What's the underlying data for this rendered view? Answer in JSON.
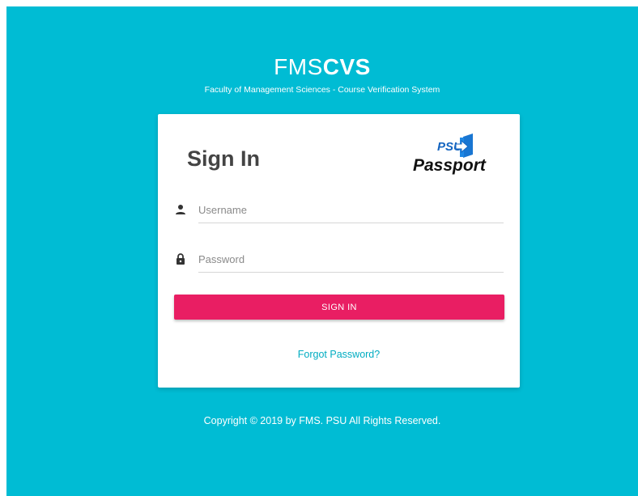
{
  "brand": {
    "title_light": "FMS",
    "title_bold": "CVS",
    "subtitle": "Faculty of Management Sciences - Course Verification System"
  },
  "login": {
    "title": "Sign In",
    "logo": {
      "top_text": "PSU",
      "bottom_text": "Passport",
      "icon": "passport-arrow-icon"
    },
    "username_placeholder": "Username",
    "password_placeholder": "Password",
    "username_icon": "user-icon",
    "password_icon": "lock-icon",
    "submit_label": "SIGN IN",
    "forgot_label": "Forgot Password?"
  },
  "footer": {
    "text": "Copyright © 2019 by FMS. PSU All Rights Reserved."
  },
  "colors": {
    "background": "#00bcd4",
    "button": "#e91e63",
    "link": "#00acc1",
    "logo_blue": "#1565c0"
  }
}
